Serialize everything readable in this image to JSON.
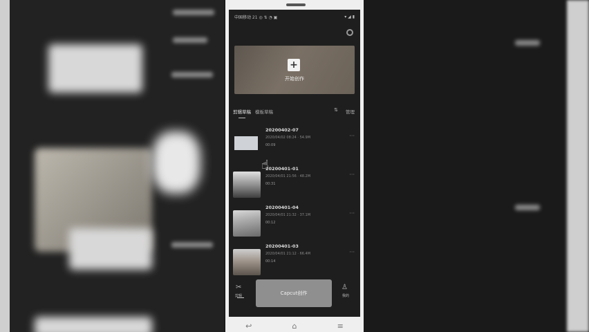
{
  "status_bar": {
    "left": "中国移动 21 ◎ ⇅ ◔ ▣",
    "right": "▾ ◢ ▮"
  },
  "settings": {
    "icon": "gear-icon"
  },
  "banner": {
    "label": "开始创作"
  },
  "tabs": {
    "active": "剪辑草稿",
    "second": "模板草稿",
    "manage": "管理"
  },
  "drafts": [
    {
      "title": "20200402-07",
      "subtitle": "2020/04/02 08:24 · 54.9M",
      "duration": "00:09"
    },
    {
      "title": "20200401-01",
      "subtitle": "2020/04/01 21:56 · 48.2M",
      "duration": "00:31"
    },
    {
      "title": "20200401-04",
      "subtitle": "2020/04/01 21:32 · 37.1M",
      "duration": "00:12"
    },
    {
      "title": "20200401-03",
      "subtitle": "2020/04/01 21:12 · 66.4M",
      "duration": "00:14"
    }
  ],
  "bottom_nav": {
    "home": "剪辑",
    "cta": "Capcut创作",
    "me": "我的"
  },
  "system_nav": {
    "back": "↩",
    "home": "⌂",
    "menu": "≡"
  }
}
